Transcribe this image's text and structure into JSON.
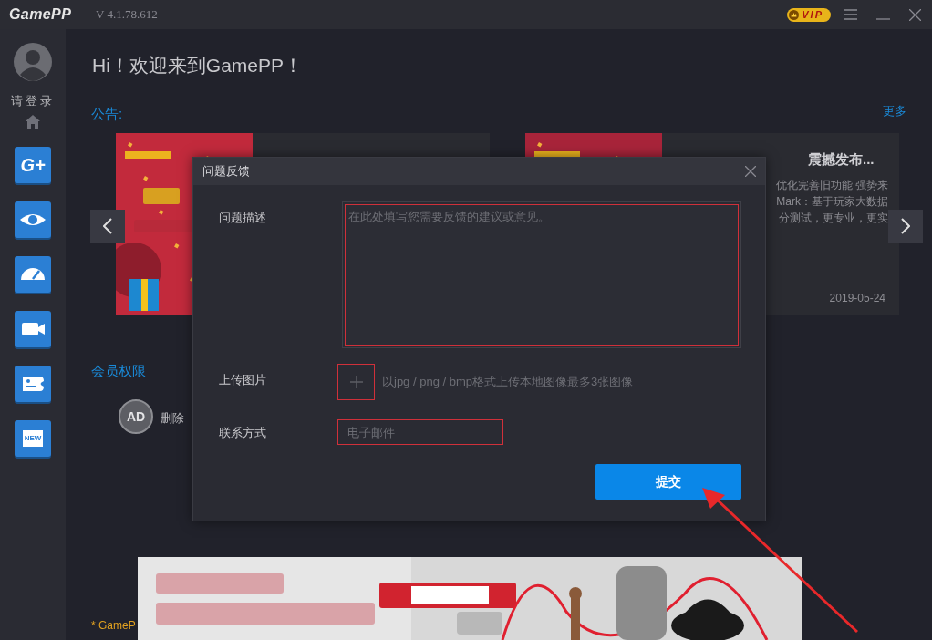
{
  "title_bar": {
    "logo": "GamePP",
    "version": "V 4.1.78.612",
    "vip_badge": "VIP"
  },
  "sidebar": {
    "login": "请登录",
    "items": [
      {
        "kind": "gplus",
        "label": "G+"
      },
      {
        "kind": "eye"
      },
      {
        "kind": "gauge"
      },
      {
        "kind": "camera"
      },
      {
        "kind": "game"
      },
      {
        "kind": "news",
        "label": "NEW"
      }
    ]
  },
  "main": {
    "greeting": "Hi！欢迎来到GamePP！",
    "notice_label": "公告:",
    "more_link": "更多",
    "cards": [
      {
        "kind": "picture"
      },
      {
        "kind": "text",
        "title": "震撼发布...",
        "lines": [
          "优化完善旧功能 强势来",
          "Mark：基于玩家大数据",
          "分测试，更专业，更实"
        ],
        "date": "2019-05-24"
      }
    ],
    "member_label": "会员权限",
    "perks": [
      {
        "icon_text": "AD",
        "label": "删除"
      }
    ],
    "footnote": "* GameP"
  },
  "dialog": {
    "title": "问题反馈",
    "fields": [
      {
        "kind": "textarea",
        "label": "问题描述",
        "placeholder": "在此处填写您需要反馈的建议或意见。"
      },
      {
        "kind": "upload",
        "label": "上传图片",
        "hint": "以jpg / png / bmp格式上传本地图像最多3张图像"
      },
      {
        "kind": "input",
        "label": "联系方式",
        "placeholder": "电子邮件"
      }
    ],
    "submit": "提交"
  }
}
